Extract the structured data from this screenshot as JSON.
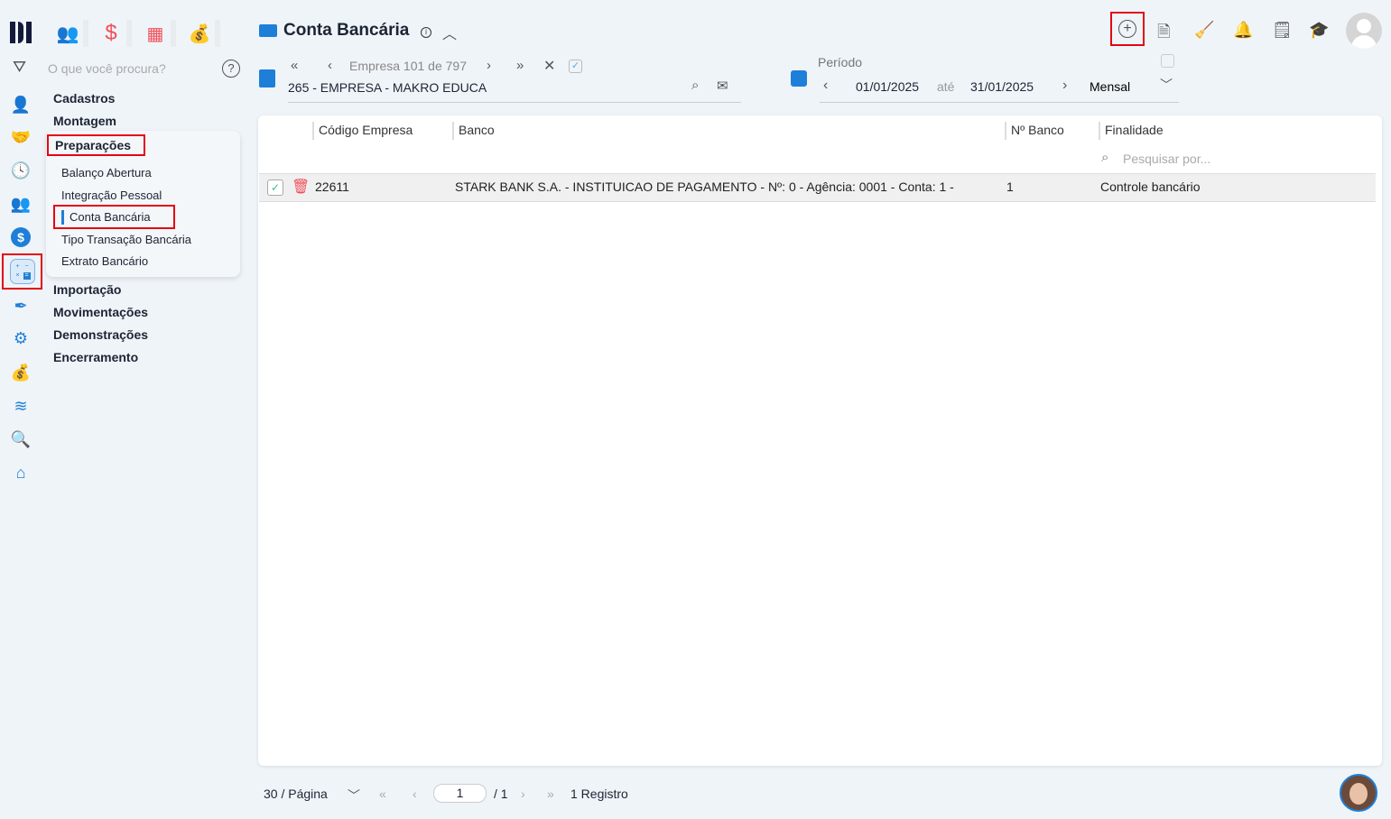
{
  "top_modules": [
    {
      "name": "people-icon",
      "color": "#1fb57a"
    },
    {
      "name": "dollar-icon",
      "color": "#f0505a"
    },
    {
      "name": "calculator-icon",
      "color": "#f0505a"
    },
    {
      "name": "money-bag-icon",
      "color": "#555555"
    }
  ],
  "search": {
    "placeholder": "O que você procura?"
  },
  "menu": {
    "sections": [
      "Cadastros",
      "Montagem"
    ],
    "open_section": "Preparações",
    "sub_items": [
      "Balanço Abertura",
      "Integração Pessoal",
      "Conta Bancária",
      "Tipo Transação Bancária",
      "Extrato Bancário"
    ],
    "after_sections": [
      "Importação",
      "Movimentações",
      "Demonstrações",
      "Encerramento"
    ]
  },
  "header": {
    "title": "Conta Bancária",
    "company_nav": "Empresa 101 de 797",
    "company": "265 - EMPRESA - MAKRO EDUCA",
    "period_label": "Período",
    "date_from": "01/01/2025",
    "date_sep": "até",
    "date_to": "31/01/2025",
    "period_type": "Mensal"
  },
  "table": {
    "columns": [
      "Código Empresa",
      "Banco",
      "Nº Banco",
      "Finalidade"
    ],
    "search_placeholder": "Pesquisar por...",
    "rows": [
      {
        "codigo": "22611",
        "banco": "STARK BANK S.A. - INSTITUICAO DE PAGAMENTO - Nº: 0 - Agência: 0001 - Conta: 1 -",
        "numero": "1",
        "finalidade": "Controle bancário"
      }
    ]
  },
  "pagination": {
    "per_page": "30 / Página",
    "page": "1",
    "total_pages": "/ 1",
    "records": "1 Registro"
  },
  "colors": {
    "accent": "#1e7fd8",
    "highlight": "#e30613",
    "background": "#eff4f9"
  }
}
